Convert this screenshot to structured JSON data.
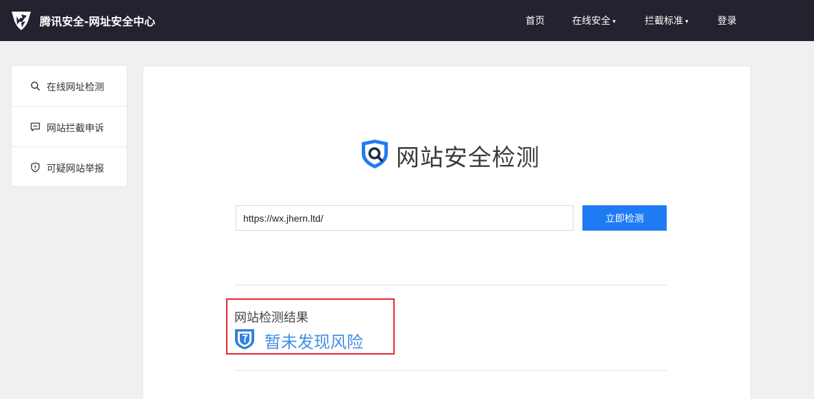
{
  "header": {
    "brand": "腾讯安全-网址安全中心",
    "nav": [
      {
        "label": "首页",
        "caret": ""
      },
      {
        "label": "在线安全",
        "caret": "▾"
      },
      {
        "label": "拦截标准",
        "caret": "▾"
      },
      {
        "label": "登录",
        "caret": ""
      }
    ]
  },
  "sidebar": {
    "items": [
      {
        "label": "在线网址检测",
        "icon": "search-icon"
      },
      {
        "label": "网站拦截申诉",
        "icon": "chat-icon"
      },
      {
        "label": "可疑网站举报",
        "icon": "shield-alert-icon"
      }
    ]
  },
  "main": {
    "title": "网站安全检测",
    "url_value": "https://wx.jhern.ltd/",
    "check_button": "立即检测",
    "result": {
      "title": "网站检测结果",
      "status": "暂未发现风险",
      "status_icon": "safe-shield-icon"
    }
  },
  "colors": {
    "header_bg": "#23232f",
    "accent": "#1e7bf4",
    "status_text": "#3f8fe6",
    "highlight_border": "#e2262b"
  }
}
